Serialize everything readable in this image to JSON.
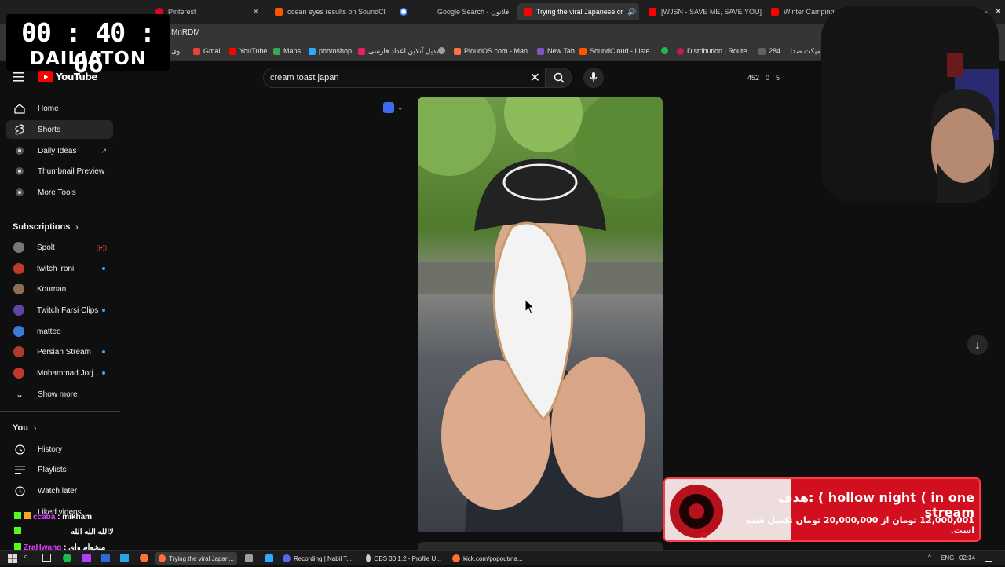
{
  "timer": {
    "time": "00 : 40 : 06",
    "label": "DAILIATON"
  },
  "tabs": [
    {
      "title": "Pinterest",
      "color": "#e60023"
    },
    {
      "title": "ocean eyes results on SoundCl",
      "color": "#ff5500"
    },
    {
      "title": "",
      "color": "#4285f4"
    },
    {
      "title": "Google Search - فلاتون",
      "color": "#4285f4"
    },
    {
      "title": "Trying the viral Japanese cr",
      "color": "#ff0000"
    },
    {
      "title": "[WJSN - SAVE ME, SAVE YOU] (",
      "color": "#ff0000"
    },
    {
      "title": "Winter Camping in Alask",
      "color": "#ff0000"
    }
  ],
  "address": "MnRDM",
  "bookmarks": [
    "وی",
    "Gmail",
    "YouTube",
    "Maps",
    "photoshop",
    "تبدیل آنلاین اعداد فارسی",
    "",
    "PloudOS.com - Man...",
    "New Tab",
    "SoundCloud - Liste...",
    "",
    "Distribution | Route...",
    "دانلود کمپکت صدا ... 284"
  ],
  "search": {
    "query": "cream toast japan",
    "clear_icon": "close-icon"
  },
  "stats": [
    "452",
    "0",
    "5"
  ],
  "sidebar": {
    "main": [
      {
        "label": "Home",
        "icon": "home-icon"
      },
      {
        "label": "Shorts",
        "icon": "shorts-icon"
      },
      {
        "label": "Daily Ideas",
        "icon": "ideas-icon"
      },
      {
        "label": "Thumbnail Preview",
        "icon": "thumbnail-icon"
      },
      {
        "label": "More Tools",
        "icon": "tools-icon"
      }
    ],
    "subs_title": "Subscriptions",
    "subs": [
      {
        "label": "Spolt",
        "color": "#888888",
        "live": true
      },
      {
        "label": "twitch ironi",
        "color": "#c0392b",
        "dot": true
      },
      {
        "label": "Kouman",
        "color": "#8e6e53",
        "dot": false
      },
      {
        "label": "Twitch Farsi Clips",
        "color": "#6441a5",
        "dot": true
      },
      {
        "label": "matteo",
        "color": "#3a7bd5",
        "dot": false
      },
      {
        "label": "Persian Stream",
        "color": "#b03a2e",
        "dot": true
      },
      {
        "label": "Mohammad Jorj...",
        "color": "#c0392b",
        "dot": true
      }
    ],
    "show_more": "Show more",
    "you_title": "You",
    "you": [
      {
        "label": "History",
        "icon": "history-icon"
      },
      {
        "label": "Playlists",
        "icon": "playlists-icon"
      },
      {
        "label": "Watch later",
        "icon": "watch-later-icon"
      },
      {
        "label": "Liked videos",
        "icon": "like-icon"
      }
    ]
  },
  "chat": [
    {
      "user": "ccaba",
      "msg": ": mikham",
      "color": "#e040fb"
    },
    {
      "user": "",
      "msg": "لاالله الله الله",
      "color": "#9e9e9e"
    },
    {
      "user": "ZraHwang",
      "msg": ": میخوام وای",
      "color": "#e040fb"
    }
  ],
  "goal": {
    "title": "هدف: ( hollow night ( in one stream",
    "subtitle": "12,000,001 تومان از 20,000,000 تومان تکمیل شده است.",
    "current": 12000001,
    "target": 20000000
  },
  "taskbar": {
    "apps": [
      {
        "label": "Trying the viral Japan...",
        "color": "#ff7139",
        "active": true
      },
      {
        "label": "",
        "color": "#9e9e9e"
      },
      {
        "label": "",
        "color": "#31a8ff"
      },
      {
        "label": "Recording | Nabil T...",
        "color": "#5865f2"
      },
      {
        "label": "OBS 30.1.2 - Profile U...",
        "color": "#cccccc"
      },
      {
        "label": "kick.com/popout/na...",
        "color": "#ff7139"
      }
    ],
    "lang": "ENG",
    "time": "02:34"
  }
}
